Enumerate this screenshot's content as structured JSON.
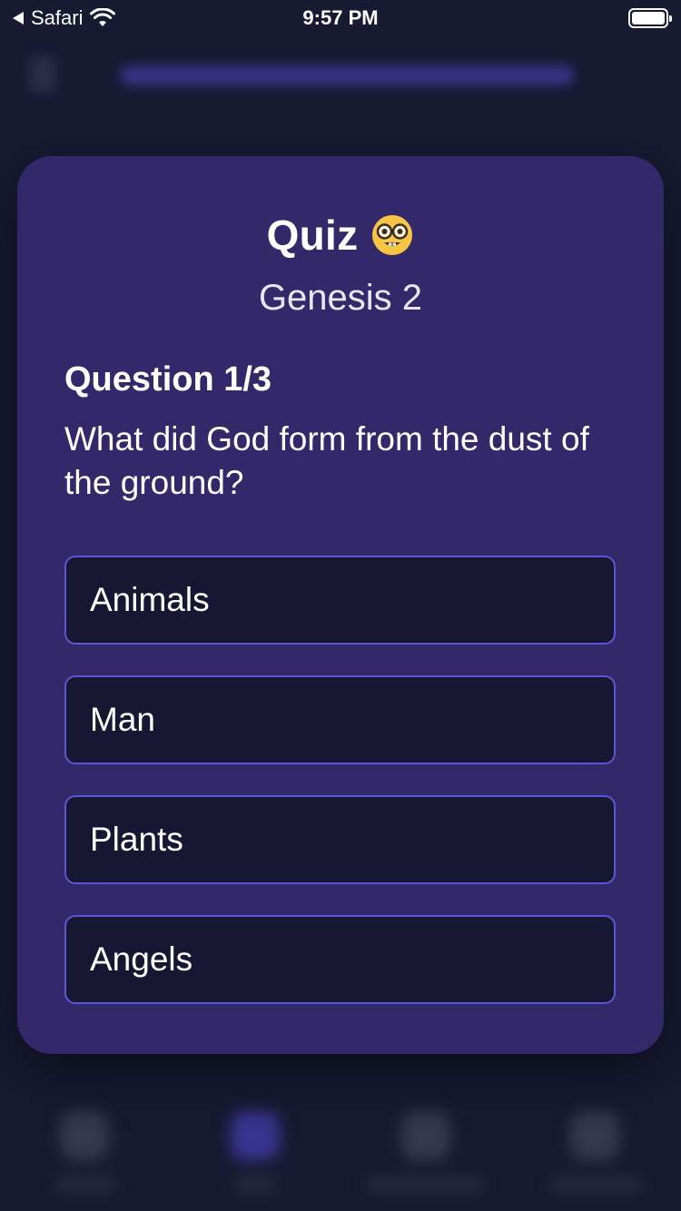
{
  "status_bar": {
    "back_app": "Safari",
    "time": "9:57 PM"
  },
  "quiz": {
    "title": "Quiz",
    "title_icon": "nerd-face-emoji",
    "subtitle": "Genesis 2",
    "question_number": "Question 1/3",
    "question_text": "What did God form from the dust of the ground?",
    "answers": [
      {
        "label": "Animals"
      },
      {
        "label": "Man"
      },
      {
        "label": "Plants"
      },
      {
        "label": "Angels"
      }
    ]
  },
  "colors": {
    "background": "#1c1f3a",
    "card": "#33296a",
    "answer_bg": "#181733",
    "answer_border": "#5d55d6",
    "accent": "#4b46b8"
  }
}
